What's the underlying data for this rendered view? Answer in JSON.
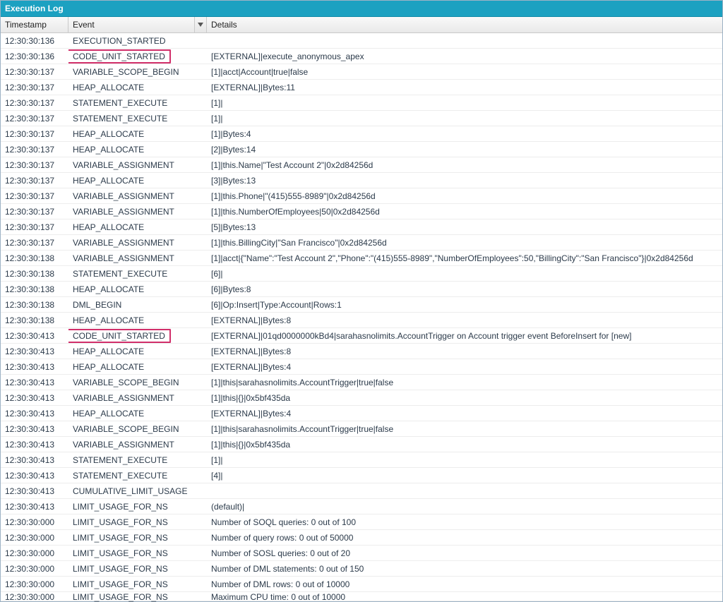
{
  "panel_title": "Execution Log",
  "columns": {
    "timestamp": "Timestamp",
    "event": "Event",
    "details": "Details"
  },
  "rows": [
    {
      "ts": "12:30:30:136",
      "ev": "EXECUTION_STARTED",
      "det": "",
      "hl": false
    },
    {
      "ts": "12:30:30:136",
      "ev": "CODE_UNIT_STARTED",
      "det": "[EXTERNAL]|execute_anonymous_apex",
      "hl": true
    },
    {
      "ts": "12:30:30:137",
      "ev": "VARIABLE_SCOPE_BEGIN",
      "det": "[1]|acct|Account|true|false",
      "hl": false
    },
    {
      "ts": "12:30:30:137",
      "ev": "HEAP_ALLOCATE",
      "det": "[EXTERNAL]|Bytes:11",
      "hl": false
    },
    {
      "ts": "12:30:30:137",
      "ev": "STATEMENT_EXECUTE",
      "det": "[1]|",
      "hl": false
    },
    {
      "ts": "12:30:30:137",
      "ev": "STATEMENT_EXECUTE",
      "det": "[1]|",
      "hl": false
    },
    {
      "ts": "12:30:30:137",
      "ev": "HEAP_ALLOCATE",
      "det": "[1]|Bytes:4",
      "hl": false
    },
    {
      "ts": "12:30:30:137",
      "ev": "HEAP_ALLOCATE",
      "det": "[2]|Bytes:14",
      "hl": false
    },
    {
      "ts": "12:30:30:137",
      "ev": "VARIABLE_ASSIGNMENT",
      "det": "[1]|this.Name|\"Test Account 2\"|0x2d84256d",
      "hl": false
    },
    {
      "ts": "12:30:30:137",
      "ev": "HEAP_ALLOCATE",
      "det": "[3]|Bytes:13",
      "hl": false
    },
    {
      "ts": "12:30:30:137",
      "ev": "VARIABLE_ASSIGNMENT",
      "det": "[1]|this.Phone|\"(415)555-8989\"|0x2d84256d",
      "hl": false
    },
    {
      "ts": "12:30:30:137",
      "ev": "VARIABLE_ASSIGNMENT",
      "det": "[1]|this.NumberOfEmployees|50|0x2d84256d",
      "hl": false
    },
    {
      "ts": "12:30:30:137",
      "ev": "HEAP_ALLOCATE",
      "det": "[5]|Bytes:13",
      "hl": false
    },
    {
      "ts": "12:30:30:137",
      "ev": "VARIABLE_ASSIGNMENT",
      "det": "[1]|this.BillingCity|\"San Francisco\"|0x2d84256d",
      "hl": false
    },
    {
      "ts": "12:30:30:138",
      "ev": "VARIABLE_ASSIGNMENT",
      "det": "[1]|acct|{\"Name\":\"Test Account 2\",\"Phone\":\"(415)555-8989\",\"NumberOfEmployees\":50,\"BillingCity\":\"San Francisco\"}|0x2d84256d",
      "hl": false
    },
    {
      "ts": "12:30:30:138",
      "ev": "STATEMENT_EXECUTE",
      "det": "[6]|",
      "hl": false
    },
    {
      "ts": "12:30:30:138",
      "ev": "HEAP_ALLOCATE",
      "det": "[6]|Bytes:8",
      "hl": false
    },
    {
      "ts": "12:30:30:138",
      "ev": "DML_BEGIN",
      "det": "[6]|Op:Insert|Type:Account|Rows:1",
      "hl": false
    },
    {
      "ts": "12:30:30:138",
      "ev": "HEAP_ALLOCATE",
      "det": "[EXTERNAL]|Bytes:8",
      "hl": false
    },
    {
      "ts": "12:30:30:413",
      "ev": "CODE_UNIT_STARTED",
      "det": "[EXTERNAL]|01qd0000000kBd4|sarahasnolimits.AccountTrigger on Account trigger event BeforeInsert for [new]",
      "hl": true
    },
    {
      "ts": "12:30:30:413",
      "ev": "HEAP_ALLOCATE",
      "det": "[EXTERNAL]|Bytes:8",
      "hl": false
    },
    {
      "ts": "12:30:30:413",
      "ev": "HEAP_ALLOCATE",
      "det": "[EXTERNAL]|Bytes:4",
      "hl": false
    },
    {
      "ts": "12:30:30:413",
      "ev": "VARIABLE_SCOPE_BEGIN",
      "det": "[1]|this|sarahasnolimits.AccountTrigger|true|false",
      "hl": false
    },
    {
      "ts": "12:30:30:413",
      "ev": "VARIABLE_ASSIGNMENT",
      "det": "[1]|this|{}|0x5bf435da",
      "hl": false
    },
    {
      "ts": "12:30:30:413",
      "ev": "HEAP_ALLOCATE",
      "det": "[EXTERNAL]|Bytes:4",
      "hl": false
    },
    {
      "ts": "12:30:30:413",
      "ev": "VARIABLE_SCOPE_BEGIN",
      "det": "[1]|this|sarahasnolimits.AccountTrigger|true|false",
      "hl": false
    },
    {
      "ts": "12:30:30:413",
      "ev": "VARIABLE_ASSIGNMENT",
      "det": "[1]|this|{}|0x5bf435da",
      "hl": false
    },
    {
      "ts": "12:30:30:413",
      "ev": "STATEMENT_EXECUTE",
      "det": "[1]|",
      "hl": false
    },
    {
      "ts": "12:30:30:413",
      "ev": "STATEMENT_EXECUTE",
      "det": "[4]|",
      "hl": false
    },
    {
      "ts": "12:30:30:413",
      "ev": "CUMULATIVE_LIMIT_USAGE",
      "det": "",
      "hl": false
    },
    {
      "ts": "12:30:30:413",
      "ev": "LIMIT_USAGE_FOR_NS",
      "det": "(default)|",
      "hl": false
    },
    {
      "ts": "12:30:30:000",
      "ev": "LIMIT_USAGE_FOR_NS",
      "det": "Number of SOQL queries: 0 out of 100",
      "hl": false
    },
    {
      "ts": "12:30:30:000",
      "ev": "LIMIT_USAGE_FOR_NS",
      "det": "Number of query rows: 0 out of 50000",
      "hl": false
    },
    {
      "ts": "12:30:30:000",
      "ev": "LIMIT_USAGE_FOR_NS",
      "det": "Number of SOSL queries: 0 out of 20",
      "hl": false
    },
    {
      "ts": "12:30:30:000",
      "ev": "LIMIT_USAGE_FOR_NS",
      "det": "Number of DML statements: 0 out of 150",
      "hl": false
    },
    {
      "ts": "12:30:30:000",
      "ev": "LIMIT_USAGE_FOR_NS",
      "det": "Number of DML rows: 0 out of 10000",
      "hl": false
    },
    {
      "ts": "12:30:30:000",
      "ev": "LIMIT_USAGE_FOR_NS",
      "det": "Maximum CPU time: 0 out of 10000",
      "hl": false
    }
  ]
}
